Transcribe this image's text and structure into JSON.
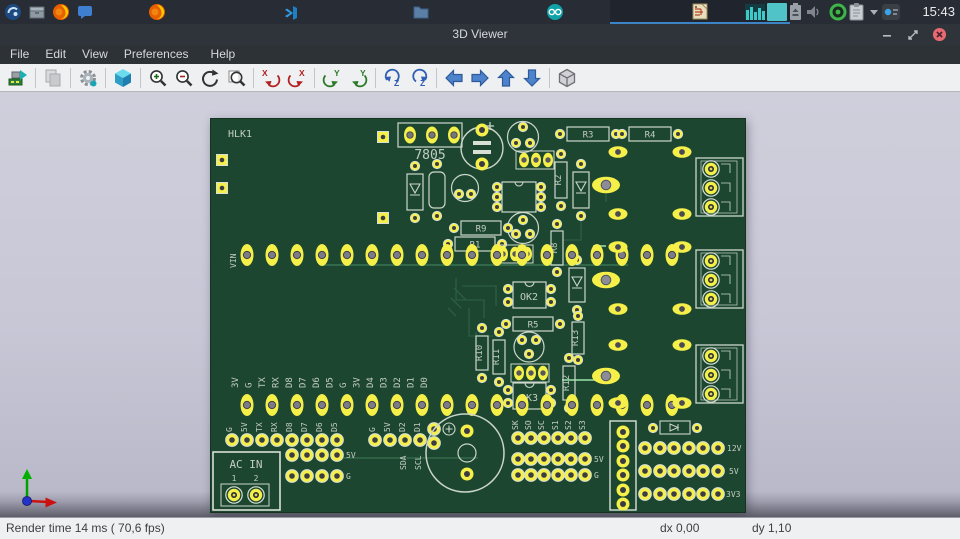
{
  "taskbar": {
    "clock": "15:43",
    "icons": [
      "launcher",
      "archive",
      "browser",
      "chat",
      "browser-task",
      "code-editor-task",
      "files-task",
      "arduino-task",
      "kicad-active-task",
      "monitor-widget",
      "teal-widget",
      "battery",
      "volume",
      "status-ring",
      "clipboard",
      "expand-arrow",
      "notification"
    ]
  },
  "window": {
    "title": "3D Viewer",
    "controls": [
      "minimize",
      "maximize",
      "close"
    ]
  },
  "menubar": {
    "items": [
      "File",
      "Edit",
      "View",
      "Preferences",
      "Help"
    ]
  },
  "toolbar": {
    "buttons": [
      "reload-board",
      "copy-image",
      "render-options",
      "set-3d-view",
      "zoom-in",
      "zoom-out",
      "redraw",
      "zoom-fit",
      "rotate-x-cw",
      "rotate-x-ccw",
      "rotate-y-cw",
      "rotate-y-ccw",
      "rotate-z-cw",
      "rotate-z-ccw",
      "pan-left",
      "pan-right",
      "pan-up",
      "pan-down",
      "orthographic-projection"
    ]
  },
  "statusbar": {
    "render_time": "Render time 14 ms ( 70,6 fps)",
    "dx": "dx 0,00",
    "dy": "dy 1,10"
  },
  "pcb": {
    "hlk_label": "HLK1",
    "regulator_label": "7805",
    "vin_label": "VIN",
    "resistors": {
      "r1": "R1",
      "r2": "R2",
      "r3": "R3",
      "r4": "R4",
      "r5": "R5",
      "r8": "R8",
      "r9": "R9",
      "r10": "R10",
      "r11": "R11",
      "r12": "R12",
      "r13": "R13"
    },
    "optocouplers": {
      "ok2": "OK2",
      "ok3": "OK3"
    },
    "ac_in": {
      "title": "AC IN",
      "pin1": "1",
      "pin2": "2"
    },
    "module_pin_labels": [
      "3V",
      "G",
      "TX",
      "RX",
      "D8",
      "D7",
      "D6",
      "D5",
      "G",
      "3V",
      "D4",
      "D3",
      "D2",
      "D1",
      "D0"
    ],
    "serial_header_labels": [
      "G",
      "5V",
      "TX",
      "RX"
    ],
    "d_header_labels": [
      "D8",
      "D7",
      "D6",
      "D5"
    ],
    "d_header_row_labels": [
      "5V",
      "G"
    ],
    "i2c_header_labels": [
      "G",
      "5V",
      "D2",
      "D1"
    ],
    "i2c_sub_labels": [
      "SDA",
      "SCL"
    ],
    "spi_header_labels": [
      "SK",
      "SO",
      "SC",
      "S1",
      "S2",
      "S3"
    ],
    "spi_row_labels": [
      "5V",
      "G"
    ],
    "power_rail_labels": [
      "12V",
      "5V",
      "3V3"
    ]
  }
}
